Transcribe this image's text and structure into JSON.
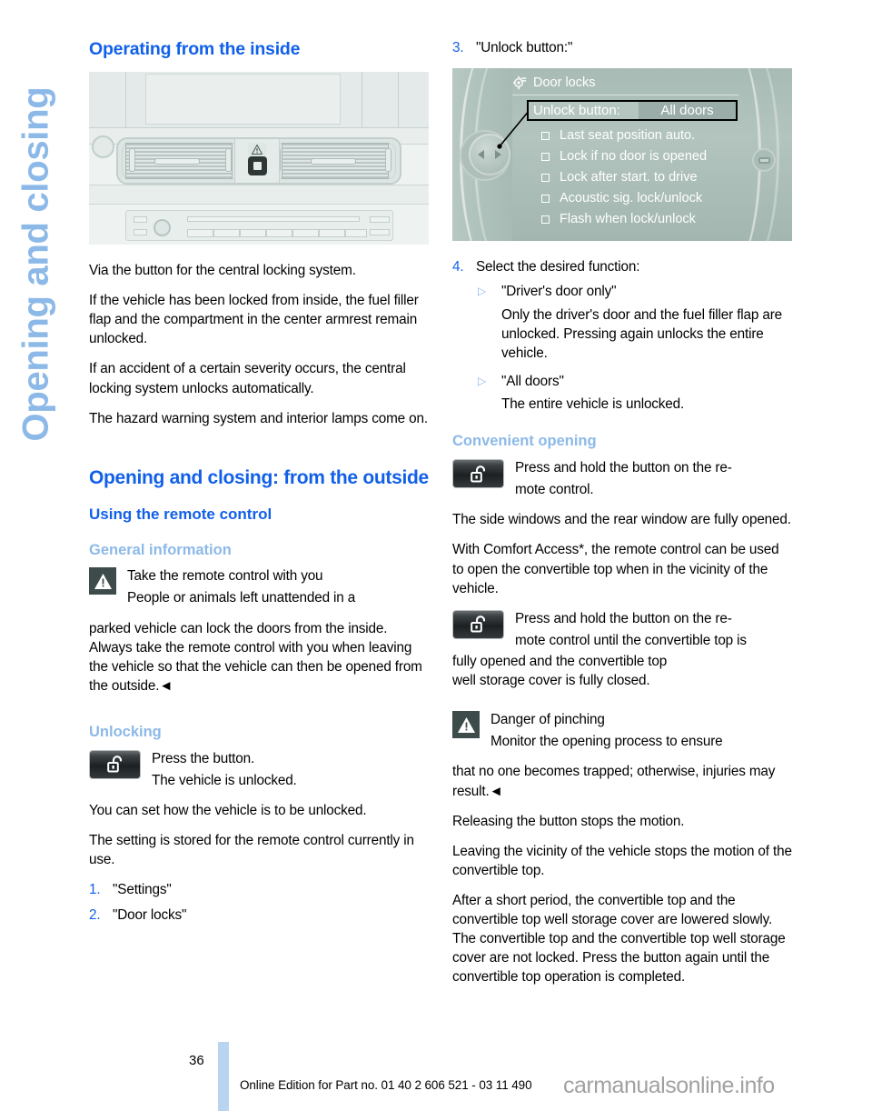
{
  "side_tab": {
    "label": "Opening and closing"
  },
  "colors": {
    "heading_blue": "#1160e8",
    "light_blue": "#8cb9e8",
    "page_bar_blue": "#b9d4ee",
    "warning_icon_bg": "#3d4c4a",
    "mid_screen_bg": "#aebfba"
  },
  "left_column": {
    "section_title": "Operating from the inside",
    "figure": {
      "name": "dashboard-central-locking-button",
      "hazard_icon": "warning-triangle-icon",
      "lock_button_icon": "door-lock-icon"
    },
    "caption": "Via the button for the central locking system.",
    "paragraph_1": "If the vehicle has been locked from inside, the fuel filler flap and the compartment in the center armrest remain unlocked.",
    "paragraph_2": "If an accident of a certain severity occurs, the central locking system unlocks automatically.",
    "paragraph_3": "The hazard warning system and interior lamps come on.",
    "big_title": "Opening and closing: from the outside",
    "sub_title": "Using the remote control",
    "general_information": {
      "heading": "General information",
      "warning_title": "Take the remote control with you",
      "warning_line_1": "People or animals left unattended in a",
      "warning_body": "parked vehicle can lock the doors from the inside. Always take the remote control with you when leaving the vehicle so that the vehicle can then be opened from the outside.◄"
    },
    "unlocking": {
      "heading": "Unlocking",
      "key_line_1": "Press the button.",
      "key_line_2": "The vehicle is unlocked.",
      "paragraph_1": "You can set how the vehicle is to be unlocked.",
      "paragraph_2": "The setting is stored for the remote control currently in use.",
      "steps": [
        {
          "number": "1.",
          "text": "\"Settings\""
        },
        {
          "number": "2.",
          "text": "\"Door locks\""
        }
      ]
    }
  },
  "right_column": {
    "step_3": {
      "number": "3.",
      "text": "\"Unlock button:\""
    },
    "mid_screen": {
      "name": "door-locks-menu",
      "gear_icon": "gear-icon",
      "header_title": "Door locks",
      "selected_row_label": "Unlock button:",
      "selected_row_value": "All doors",
      "options": [
        "Last seat position auto.",
        "Lock if no door is opened",
        "Lock after start. to drive",
        "Acoustic sig. lock/unlock",
        "Flash when lock/unlock"
      ]
    },
    "step_4": {
      "number": "4.",
      "text": "Select the desired function:",
      "bullets": [
        {
          "marker": "▷",
          "label": "\"Driver's door only\"",
          "body": "Only the driver's door and the fuel filler flap are unlocked. Pressing again unlocks the entire vehicle."
        },
        {
          "marker": "▷",
          "label": "\"All doors\"",
          "body": "The entire vehicle is unlocked."
        }
      ]
    },
    "convenient_opening": {
      "heading": "Convenient opening",
      "key_block_1_line_1": "Press and hold the button on the re-",
      "key_block_1_line_2": "mote control.",
      "paragraph_1": "The side windows and the rear window are fully opened.",
      "paragraph_2": "With Comfort Access*, the remote control can be used to open the convertible top when in the vicinity of the vehicle.",
      "key_block_2_line_1": "Press and hold the button on the re-",
      "key_block_2_line_2": "mote control until the convertible top is",
      "key_block_2_rest": "fully opened and the convertible top",
      "key_block_2_rest_2": "well storage cover is fully closed.",
      "warning_title": "Danger of pinching",
      "warning_line_1": "Monitor the opening process to ensure",
      "warning_body": "that no one becomes trapped; otherwise, injuries may result.◄",
      "paragraph_3": "Releasing the button stops the motion.",
      "paragraph_4": "Leaving the vicinity of the vehicle stops the motion of the convertible top.",
      "paragraph_5": "After a short period, the convertible top and the convertible top well storage cover are lowered slowly. The convertible top and the convertible top well storage cover are not locked. Press the button again until the convertible top operation is completed."
    }
  },
  "footer": {
    "page_number": "36",
    "online_edition": "Online Edition for Part no. 01 40 2 606 521 - 03 11 490",
    "watermark": "carmanualsonline.info"
  }
}
